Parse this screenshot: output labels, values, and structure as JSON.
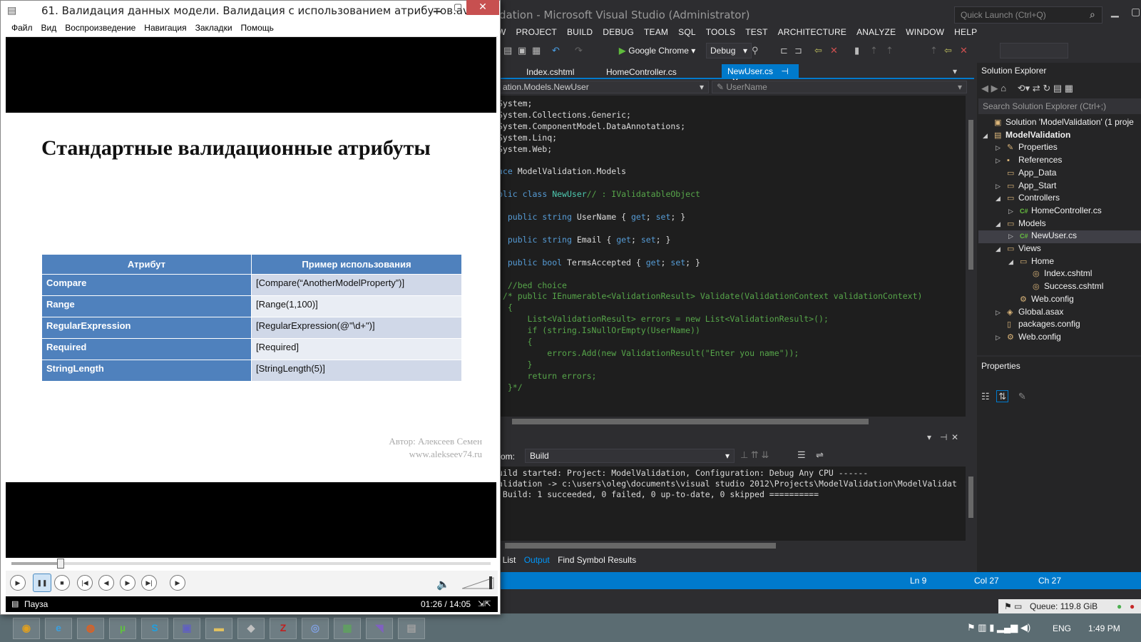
{
  "vs": {
    "title": "dation - Microsoft Visual Studio (Administrator)",
    "quick_launch": "Quick Launch (Ctrl+Q)",
    "menu": [
      "W",
      "PROJECT",
      "BUILD",
      "DEBUG",
      "TEAM",
      "SQL",
      "TOOLS",
      "TEST",
      "ARCHITECTURE",
      "ANALYZE",
      "WINDOW",
      "HELP"
    ],
    "run_target": "Google Chrome",
    "config": "Debug",
    "tabs": [
      "Index.cshtml",
      "HomeController.cs",
      "NewUser.cs"
    ],
    "nav_left": "ation.Models.NewUser",
    "nav_right": "UserName",
    "code_lines": [
      "System;",
      "System.Collections.Generic;",
      "System.ComponentModel.DataAnnotations;",
      "System.Linq;",
      "System.Web;",
      "",
      "ace ModelValidation.Models",
      "",
      "blic class NewUser// : IValidatableObject",
      "",
      "  public string UserName { get; set; }",
      "",
      "  public string Email { get; set; }",
      "",
      "  public bool TermsAccepted { get; set; }",
      "",
      "  //bed choice",
      " /* public IEnumerable<ValidationResult> Validate(ValidationContext validationContext)",
      "  {",
      "      List<ValidationResult> errors = new List<ValidationResult>();",
      "      if (string.IsNullOrEmpty(UserName))",
      "      {",
      "          errors.Add(new ValidationResult(\"Enter you name\"));",
      "      }",
      "      return errors;",
      "  }*/"
    ],
    "output_from_label": "rom:",
    "output_source": "Build",
    "output_lines": [
      "uild started: Project: ModelValidation, Configuration: Debug Any CPU ------",
      "alidation -> c:\\users\\oleg\\documents\\visual studio 2012\\Projects\\ModelValidation\\ModelValidat",
      " Build: 1 succeeded, 0 failed, 0 up-to-date, 0 skipped =========="
    ],
    "bottom_tabs": [
      "t List",
      "Output",
      "Find Symbol Results"
    ],
    "status": {
      "ln": "Ln 9",
      "col": "Col 27",
      "ch": "Ch 27"
    },
    "solution_explorer": {
      "title": "Solution Explorer",
      "search": "Search Solution Explorer (Ctrl+;)",
      "items": [
        {
          "label": "Solution 'ModelValidation' (1 proje",
          "depth": 0,
          "arrow": "",
          "icon": "▣"
        },
        {
          "label": "ModelValidation",
          "depth": 0,
          "arrow": "◢",
          "icon": "▤",
          "bold": true
        },
        {
          "label": "Properties",
          "depth": 1,
          "arrow": "▷",
          "icon": "✎"
        },
        {
          "label": "References",
          "depth": 1,
          "arrow": "▷",
          "icon": "▪"
        },
        {
          "label": "App_Data",
          "depth": 1,
          "arrow": "",
          "icon": "▭"
        },
        {
          "label": "App_Start",
          "depth": 1,
          "arrow": "▷",
          "icon": "▭"
        },
        {
          "label": "Controllers",
          "depth": 1,
          "arrow": "◢",
          "icon": "▭"
        },
        {
          "label": "HomeController.cs",
          "depth": 2,
          "arrow": "▷",
          "icon": "C#"
        },
        {
          "label": "Models",
          "depth": 1,
          "arrow": "◢",
          "icon": "▭"
        },
        {
          "label": "NewUser.cs",
          "depth": 2,
          "arrow": "▷",
          "icon": "C#",
          "selected": true
        },
        {
          "label": "Views",
          "depth": 1,
          "arrow": "◢",
          "icon": "▭"
        },
        {
          "label": "Home",
          "depth": 2,
          "arrow": "◢",
          "icon": "▭"
        },
        {
          "label": "Index.cshtml",
          "depth": 3,
          "arrow": "",
          "icon": "◎"
        },
        {
          "label": "Success.cshtml",
          "depth": 3,
          "arrow": "",
          "icon": "◎"
        },
        {
          "label": "Web.config",
          "depth": 2,
          "arrow": "",
          "icon": "⚙"
        },
        {
          "label": "Global.asax",
          "depth": 1,
          "arrow": "▷",
          "icon": "◈"
        },
        {
          "label": "packages.config",
          "depth": 1,
          "arrow": "",
          "icon": "▯"
        },
        {
          "label": "Web.config",
          "depth": 1,
          "arrow": "▷",
          "icon": "⚙"
        }
      ]
    },
    "properties_title": "Properties"
  },
  "tray": {
    "queue": "Queue: 119.8 GiB",
    "lang": "ENG",
    "time": "1:49 PM"
  },
  "taskbar_apps": [
    {
      "name": "chrome",
      "glyph": "◉",
      "color": "#e0a020"
    },
    {
      "name": "ie",
      "glyph": "e",
      "color": "#3aa0e0"
    },
    {
      "name": "firefox",
      "glyph": "◍",
      "color": "#e06020"
    },
    {
      "name": "utorrent",
      "glyph": "µ",
      "color": "#60c040"
    },
    {
      "name": "skype",
      "glyph": "S",
      "color": "#20a0e0"
    },
    {
      "name": "save",
      "glyph": "▣",
      "color": "#6060c0"
    },
    {
      "name": "explorer",
      "glyph": "▬",
      "color": "#e0c060"
    },
    {
      "name": "box",
      "glyph": "◆",
      "color": "#c0c0c0"
    },
    {
      "name": "filezilla",
      "glyph": "Z",
      "color": "#c02020"
    },
    {
      "name": "network",
      "glyph": "◎",
      "color": "#80a0e0"
    },
    {
      "name": "installer",
      "glyph": "▦",
      "color": "#60a060"
    },
    {
      "name": "visual-studio",
      "glyph": "◥",
      "color": "#8060c0"
    },
    {
      "name": "media-player",
      "glyph": "▤",
      "color": "#a0a0a0"
    }
  ],
  "player": {
    "title": "61. Валидация данных модели. Валидация с использованием атрибутов.avi",
    "menu": [
      "Файл",
      "Вид",
      "Воспроизведение",
      "Навигация",
      "Закладки",
      "Помощь"
    ],
    "slide_title": "Стандартные валидационные атрибуты",
    "table_headers": [
      "Атрибут",
      "Пример использования"
    ],
    "table_rows": [
      [
        "Compare",
        "[Compare(“AnotherModelProperty”)]"
      ],
      [
        "Range",
        "[Range(1,100)]"
      ],
      [
        "RegularExpression",
        "[RegularExpression(@\"\\d+\")]"
      ],
      [
        "Required",
        "[Required]"
      ],
      [
        "StringLength",
        "[StringLength(5)]"
      ]
    ],
    "author_line1": "Автор: Алексеев Семен",
    "author_line2": "www.alekseev74.ru",
    "state": "Пауза",
    "time": "01:26 / 14:05",
    "progress": 0.102
  }
}
